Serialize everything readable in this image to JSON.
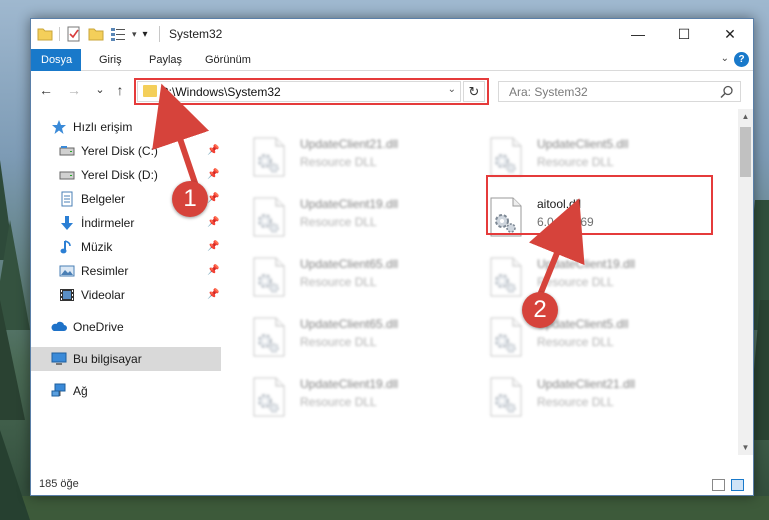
{
  "window": {
    "title": "System32",
    "controls": {
      "minimize": "—",
      "maximize": "☐",
      "close": "✕"
    }
  },
  "ribbon": {
    "tabs": [
      {
        "label": "Dosya",
        "active": true
      },
      {
        "label": "Giriş",
        "active": false
      },
      {
        "label": "Paylaş",
        "active": false
      },
      {
        "label": "Görünüm",
        "active": false
      }
    ],
    "help": "?"
  },
  "nav": {
    "back": "←",
    "forward": "→",
    "recent": "⌄",
    "up": "↑",
    "address": "C:\\Windows\\System32",
    "refresh": "↻",
    "search_placeholder": "Ara: System32"
  },
  "sidebar": {
    "items": [
      {
        "label": "Hızlı erişim",
        "icon": "star-icon"
      },
      {
        "label": "Yerel Disk (C:)",
        "icon": "drive-icon",
        "pinned": true
      },
      {
        "label": "Yerel Disk (D:)",
        "icon": "drive-icon",
        "pinned": true
      },
      {
        "label": "Belgeler",
        "icon": "documents-icon",
        "pinned": true
      },
      {
        "label": "İndirmeler",
        "icon": "download-icon",
        "pinned": true
      },
      {
        "label": "Müzik",
        "icon": "music-icon",
        "pinned": true
      },
      {
        "label": "Resimler",
        "icon": "pictures-icon",
        "pinned": true
      },
      {
        "label": "Videolar",
        "icon": "videos-icon",
        "pinned": true
      },
      {
        "label": "OneDrive",
        "icon": "onedrive-icon"
      },
      {
        "label": "Bu bilgisayar",
        "icon": "computer-icon",
        "selected": true
      },
      {
        "label": "Ağ",
        "icon": "network-icon"
      }
    ]
  },
  "files": [
    {
      "name": "UpdateClient21.dll",
      "desc": "Resource DLL",
      "blurred": true
    },
    {
      "name": "UpdateClient5.dll",
      "desc": "Resource DLL",
      "blurred": true
    },
    {
      "name": "UpdateClient19.dll",
      "desc": "Resource DLL",
      "blurred": true
    },
    {
      "name": "aitool.dll",
      "desc": "6.0.0.8169",
      "blurred": false
    },
    {
      "name": "UpdateClient65.dll",
      "desc": "Resource DLL",
      "blurred": true
    },
    {
      "name": "UpdateClient19.dll",
      "desc": "Resource DLL",
      "blurred": true
    },
    {
      "name": "UpdateClient65.dll",
      "desc": "Resource DLL",
      "blurred": true
    },
    {
      "name": "UpdateClient5.dll",
      "desc": "Resource DLL",
      "blurred": true
    },
    {
      "name": "UpdateClient19.dll",
      "desc": "Resource DLL",
      "blurred": true
    },
    {
      "name": "UpdateClient21.dll",
      "desc": "Resource DLL",
      "blurred": true
    }
  ],
  "status": {
    "count": "185 öğe"
  },
  "callouts": {
    "one": "1",
    "two": "2"
  },
  "colors": {
    "accent": "#1979ca",
    "highlight": "#e53b3b",
    "callout": "#d6433b",
    "folder": "#f4cf5a"
  }
}
